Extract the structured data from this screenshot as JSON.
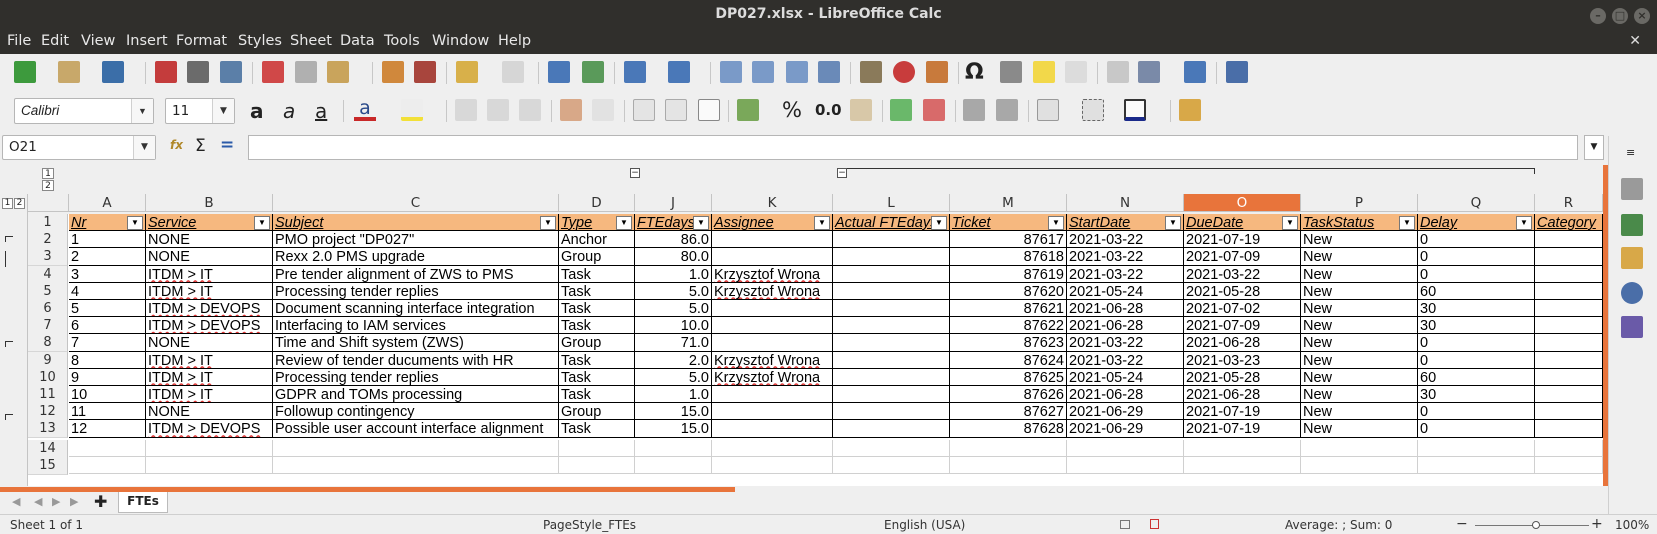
{
  "window": {
    "title": "DP027.xlsx - LibreOffice Calc"
  },
  "menu": [
    "File",
    "Edit",
    "View",
    "Insert",
    "Format",
    "Styles",
    "Sheet",
    "Data",
    "Tools",
    "Window",
    "Help"
  ],
  "formatting": {
    "font_name": "Calibri",
    "font_size": "11",
    "number_format_label": "0.0"
  },
  "formula_bar": {
    "name_box": "O21",
    "sigma": "Σ",
    "equals": "=",
    "fx": "fx",
    "formula": ""
  },
  "outline": {
    "level1": "1",
    "level2": "2",
    "collapse": "−"
  },
  "columns": [
    "A",
    "B",
    "C",
    "D",
    "J",
    "K",
    "L",
    "M",
    "N",
    "O",
    "P",
    "Q",
    "R"
  ],
  "header": [
    "Nr",
    "Service",
    "Subject",
    "Type",
    "FTEdays",
    "Assignee",
    "Actual FTEdays",
    "Ticket",
    "StartDate",
    "DueDate",
    "TaskStatus",
    "Delay",
    "Category"
  ],
  "rows": [
    {
      "n": "1",
      "cells": [
        "1",
        "NONE",
        "PMO project \"DP027\"",
        "Anchor",
        "86.0",
        "",
        "",
        "87617",
        "2021-03-22",
        "2021-07-19",
        "New",
        "0",
        ""
      ]
    },
    {
      "n": "2",
      "cells": [
        "2",
        "NONE",
        "Rexx 2.0 PMS upgrade",
        "Group",
        "80.0",
        "",
        "",
        "87618",
        "2021-03-22",
        "2021-07-09",
        "New",
        "0",
        ""
      ]
    },
    {
      "n": "3",
      "cells": [
        "3",
        "ITDM > IT",
        "Pre tender alignment of ZWS to PMS",
        "Task",
        "1.0",
        "Krzysztof Wrona",
        "",
        "87619",
        "2021-03-22",
        "2021-03-22",
        "New",
        "0",
        ""
      ]
    },
    {
      "n": "4",
      "cells": [
        "4",
        "ITDM > IT",
        "Processing tender replies",
        "Task",
        "5.0",
        "Krzysztof Wrona",
        "",
        "87620",
        "2021-05-24",
        "2021-05-28",
        "New",
        "60",
        ""
      ]
    },
    {
      "n": "5",
      "cells": [
        "5",
        "ITDM > DEVOPS",
        "Document scanning interface integration",
        "Task",
        "5.0",
        "",
        "",
        "87621",
        "2021-06-28",
        "2021-07-02",
        "New",
        "30",
        ""
      ]
    },
    {
      "n": "6",
      "cells": [
        "6",
        "ITDM > DEVOPS",
        "Interfacing to IAM services",
        "Task",
        "10.0",
        "",
        "",
        "87622",
        "2021-06-28",
        "2021-07-09",
        "New",
        "30",
        ""
      ]
    },
    {
      "n": "7",
      "cells": [
        "7",
        "NONE",
        "Time and Shift system (ZWS)",
        "Group",
        "71.0",
        "",
        "",
        "87623",
        "2021-03-22",
        "2021-06-28",
        "New",
        "0",
        ""
      ]
    },
    {
      "n": "8",
      "cells": [
        "8",
        "ITDM > IT",
        "Review of tender ducuments with HR",
        "Task",
        "2.0",
        "Krzysztof Wrona",
        "",
        "87624",
        "2021-03-22",
        "2021-03-23",
        "New",
        "0",
        ""
      ]
    },
    {
      "n": "9",
      "cells": [
        "9",
        "ITDM > IT",
        "Processing tender replies",
        "Task",
        "5.0",
        "Krzysztof Wrona",
        "",
        "87625",
        "2021-05-24",
        "2021-05-28",
        "New",
        "60",
        ""
      ]
    },
    {
      "n": "10",
      "cells": [
        "10",
        "ITDM > IT",
        "GDPR and TOMs processing",
        "Task",
        "1.0",
        "",
        "",
        "87626",
        "2021-06-28",
        "2021-06-28",
        "New",
        "30",
        ""
      ]
    },
    {
      "n": "11",
      "cells": [
        "11",
        "NONE",
        "Followup contingency",
        "Group",
        "15.0",
        "",
        "",
        "87627",
        "2021-06-29",
        "2021-07-19",
        "New",
        "0",
        ""
      ]
    },
    {
      "n": "12",
      "cells": [
        "12",
        "ITDM > DEVOPS",
        "Possible user account interface alignment",
        "Task",
        "15.0",
        "",
        "",
        "87628",
        "2021-06-29",
        "2021-07-19",
        "New",
        "0",
        ""
      ]
    }
  ],
  "empty_rows": [
    "14",
    "15"
  ],
  "sheet_tab": "FTEs",
  "status": {
    "sheet": "Sheet 1 of 1",
    "page_style": "PageStyle_FTEs",
    "language": "English (USA)",
    "aggregate": "Average: ; Sum: 0",
    "zoom": "100%"
  },
  "colors": {
    "header_fill": "#f6b87f",
    "selected_col": "#e8743b",
    "titlebar": "#302f2c"
  }
}
